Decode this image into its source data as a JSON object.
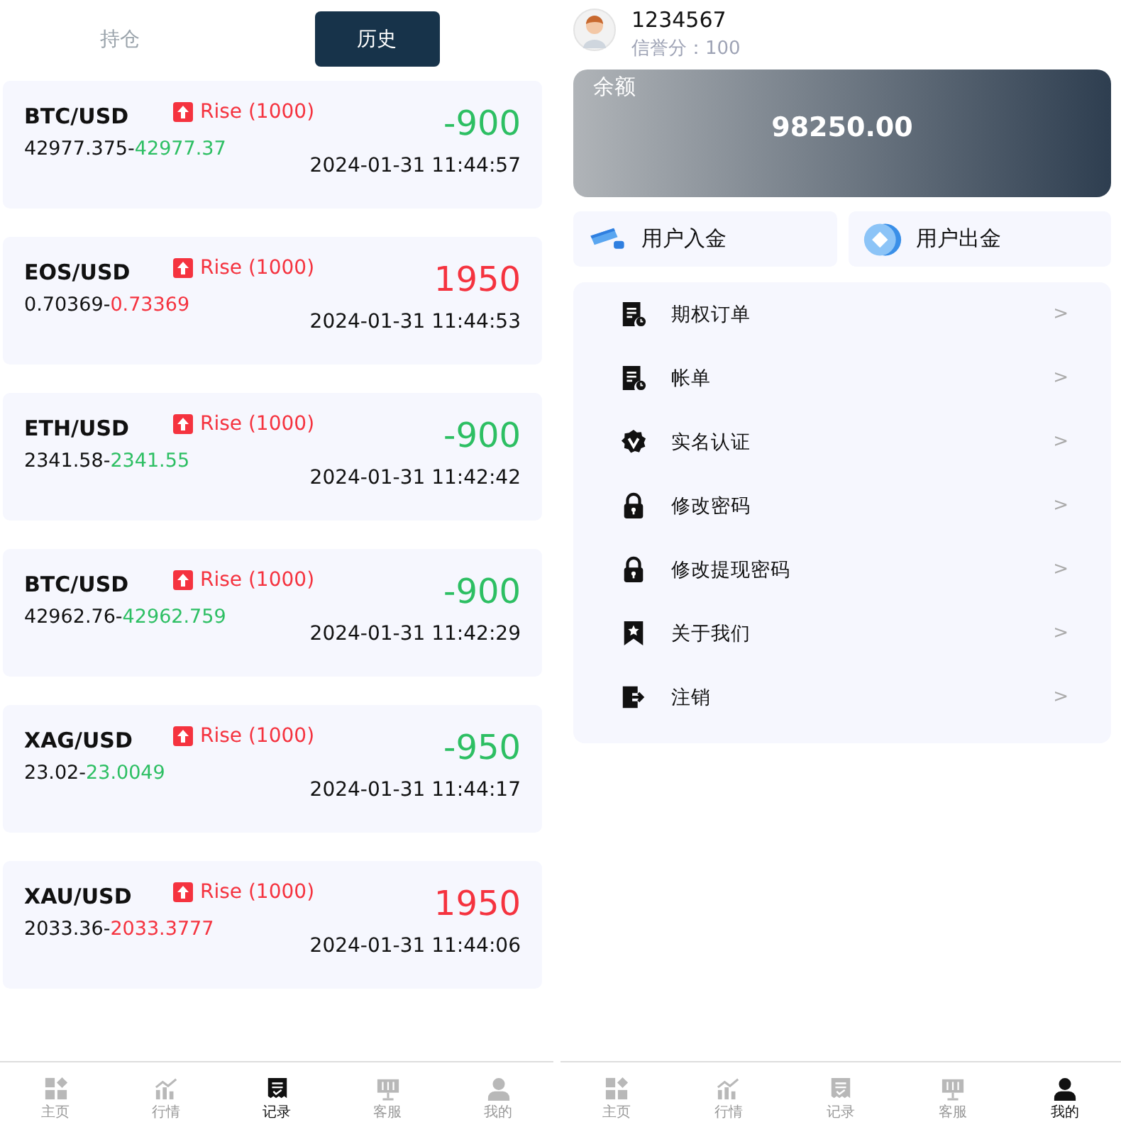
{
  "orders_screen": {
    "tabs": [
      {
        "label": "持仓",
        "selected": false
      },
      {
        "label": "历史",
        "selected": true
      }
    ],
    "orders": [
      {
        "pair": "BTC/USD",
        "direction": "Rise (1000)",
        "pnl": "-900",
        "open_price": "42977.375-",
        "close_price": "42977.37",
        "time": "2024-01-31 11:44:57",
        "color": "#2dbf63"
      },
      {
        "pair": "EOS/USD",
        "direction": "Rise (1000)",
        "pnl": "1950",
        "open_price": "0.70369-",
        "close_price": "0.73369",
        "time": "2024-01-31 11:44:53",
        "color": "#f5333f"
      },
      {
        "pair": "ETH/USD",
        "direction": "Rise (1000)",
        "pnl": "-900",
        "open_price": "2341.58-",
        "close_price": "2341.55",
        "time": "2024-01-31 11:42:42",
        "color": "#2dbf63"
      },
      {
        "pair": "BTC/USD",
        "direction": "Rise (1000)",
        "pnl": "-900",
        "open_price": "42962.76-",
        "close_price": "42962.759",
        "time": "2024-01-31 11:42:29",
        "color": "#2dbf63"
      },
      {
        "pair": "XAG/USD",
        "direction": "Rise (1000)",
        "pnl": "-950",
        "open_price": "23.02-",
        "close_price": "23.0049",
        "time": "2024-01-31 11:44:17",
        "color": "#2dbf63"
      },
      {
        "pair": "XAU/USD",
        "direction": "Rise (1000)",
        "pnl": "1950",
        "open_price": "2033.36-",
        "close_price": "2033.3777",
        "time": "2024-01-31 11:44:06",
        "color": "#f5333f"
      }
    ],
    "nav": [
      {
        "label": "主页",
        "kind": "home",
        "selected": false
      },
      {
        "label": "行情",
        "kind": "chart",
        "selected": false
      },
      {
        "label": "记录",
        "kind": "record",
        "selected": true
      },
      {
        "label": "客服",
        "kind": "service",
        "selected": false
      },
      {
        "label": "我的",
        "kind": "user",
        "selected": false
      }
    ]
  },
  "profile_screen": {
    "user": {
      "account": "1234567",
      "credit": "信誉分：100"
    },
    "balance": {
      "label": "余额",
      "amount": "98250.00"
    },
    "actions": [
      {
        "label": "用户入金",
        "kind": "deposit"
      },
      {
        "label": "用户出金",
        "kind": "withdraw"
      }
    ],
    "menu": [
      {
        "label": "期权订单",
        "kind": "document"
      },
      {
        "label": "帐单",
        "kind": "document"
      },
      {
        "label": "实名认证",
        "kind": "badge"
      },
      {
        "label": "修改密码",
        "kind": "lock"
      },
      {
        "label": "修改提现密码",
        "kind": "lock"
      },
      {
        "label": "关于我们",
        "kind": "bookmark"
      },
      {
        "label": "注销",
        "kind": "logout"
      }
    ],
    "chevron": ">",
    "nav": [
      {
        "label": "主页",
        "kind": "home",
        "selected": false
      },
      {
        "label": "行情",
        "kind": "chart",
        "selected": false
      },
      {
        "label": "记录",
        "kind": "record",
        "selected": false
      },
      {
        "label": "客服",
        "kind": "service",
        "selected": false
      },
      {
        "label": "我的",
        "kind": "user",
        "selected": true
      }
    ]
  }
}
